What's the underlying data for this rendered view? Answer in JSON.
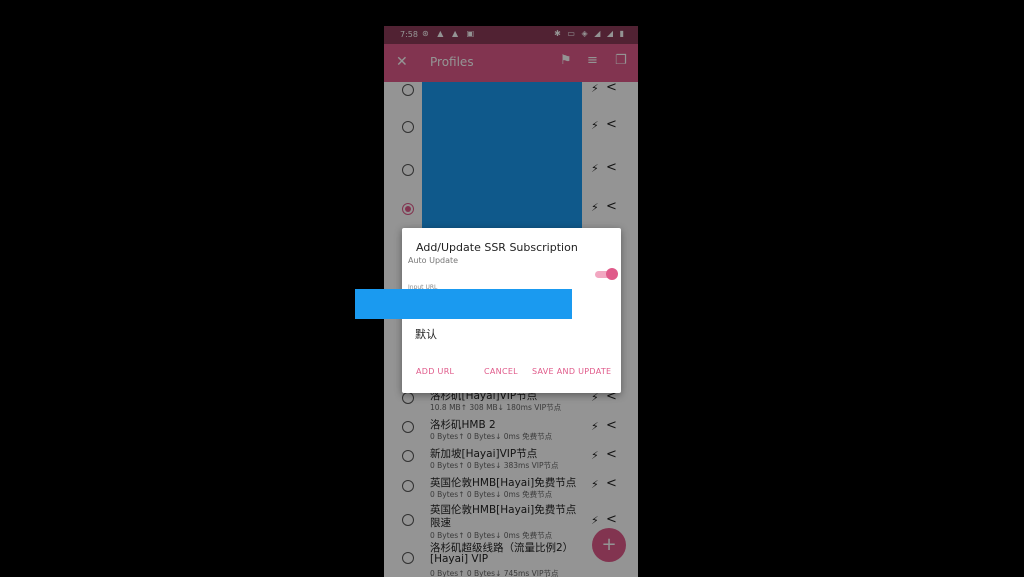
{
  "status_bar": {
    "time": "7:58",
    "left_icons": "⊛ ▲ ▲ ▣",
    "right_icons": "✱ ▭ ◈ ◢ ◢ ▮"
  },
  "app_bar": {
    "title": "Profiles",
    "close_icon": "close-icon",
    "flag_icon": "flag-icon",
    "sort_icon": "sort-icon",
    "copy_icon": "copy-icon"
  },
  "dialog": {
    "title": "Add/Update SSR Subscription",
    "auto_update_label": "Auto Update",
    "field_label": "Input URL",
    "group_name": "默认",
    "buttons": {
      "add_url": "ADD URL",
      "cancel": "CANCEL",
      "save_update": "SAVE AND UPDATE"
    }
  },
  "profiles": [
    {
      "title": "洛杉矶[Hayai]VIP节点",
      "subtitle": "10.8 MB↑ 308 MB↓ 180ms VIP节点"
    },
    {
      "title": "洛杉矶HMB 2",
      "subtitle": "0 Bytes↑ 0 Bytes↓ 0ms 免费节点"
    },
    {
      "title": "新加坡[Hayai]VIP节点",
      "subtitle": "0 Bytes↑ 0 Bytes↓ 383ms VIP节点"
    },
    {
      "title": "英国伦敦HMB[Hayai]免费节点",
      "subtitle": "0 Bytes↑ 0 Bytes↓ 0ms 免费节点"
    },
    {
      "title": "英国伦敦HMB[Hayai]免费节点",
      "title2": "限速",
      "subtitle": "0 Bytes↑ 0 Bytes↓ 0ms 免费节点"
    },
    {
      "title": "洛杉矶超级线路（流量比例2）",
      "title2": "[Hayai] VIP",
      "subtitle": "0 Bytes↑ 0 Bytes↓ 745ms VIP节点"
    }
  ],
  "fab": {
    "label": "+"
  },
  "colors": {
    "accent": "#e05a8a",
    "status_bar": "#8c3b58",
    "redaction": "#1a9af0"
  }
}
